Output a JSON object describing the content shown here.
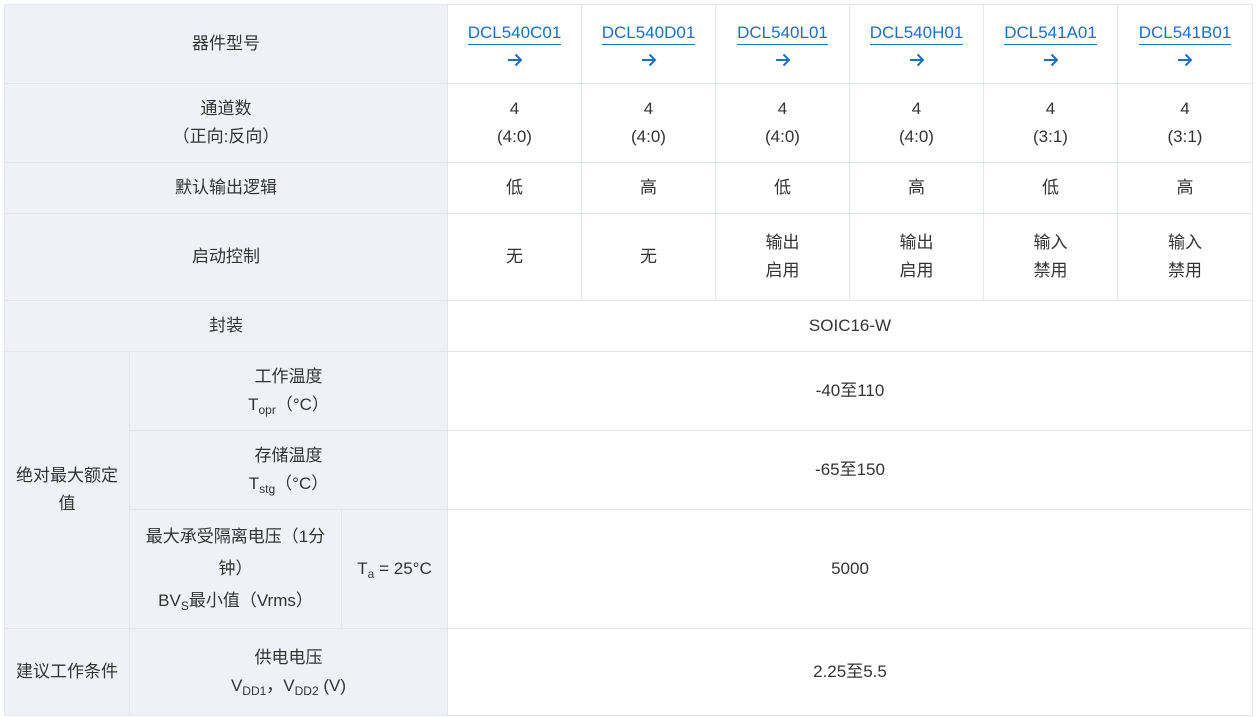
{
  "header_label": "器件型号",
  "parts": [
    "DCL540C01",
    "DCL540D01",
    "DCL540L01",
    "DCL540H01",
    "DCL541A01",
    "DCL541B01"
  ],
  "channels": {
    "label_1": "通道数",
    "label_2": "（正向:反向）",
    "count": [
      "4",
      "4",
      "4",
      "4",
      "4",
      "4"
    ],
    "ratio": [
      "(4:0)",
      "(4:0)",
      "(4:0)",
      "(4:0)",
      "(3:1)",
      "(3:1)"
    ]
  },
  "default_output": {
    "label": "默认输出逻辑",
    "values": [
      "低",
      "高",
      "低",
      "高",
      "低",
      "高"
    ]
  },
  "enable": {
    "label": "启动控制",
    "values": [
      [
        "无"
      ],
      [
        "无"
      ],
      [
        "输出",
        "启用"
      ],
      [
        "输出",
        "启用"
      ],
      [
        "输入",
        "禁用"
      ],
      [
        "输入",
        "禁用"
      ]
    ]
  },
  "package": {
    "label": "封装",
    "value": "SOIC16-W"
  },
  "abs_max": {
    "label": "绝对最大额定值",
    "opr": {
      "label": "工作温度",
      "sym": "T",
      "sub": "opr",
      "unit": "（°C）",
      "value": "-40至110"
    },
    "stg": {
      "label": "存储温度",
      "sym": "T",
      "sub": "stg",
      "unit": "（°C）",
      "value": "-65至150"
    },
    "iso": {
      "label_1": "最大承受隔离电压（1分",
      "label_2": "钟）",
      "sym": "BV",
      "sub": "S",
      "label_3": "最小值（Vrms）",
      "cond_sym": "T",
      "cond_sub": "a",
      "cond_val": " = 25°C",
      "value": "5000"
    }
  },
  "recommended": {
    "label": "建议工作条件",
    "vdd": {
      "label": "供电电压",
      "sym1": "V",
      "sub1": "DD1",
      "sep": "，",
      "sym2": "V",
      "sub2": "DD2",
      "unit": " (V)",
      "value": "2.25至5.5"
    }
  },
  "colors": {
    "header_bg": "#eef2f7",
    "link": "#1a6fc9",
    "border": "#e3e6ea",
    "text": "#333333"
  }
}
